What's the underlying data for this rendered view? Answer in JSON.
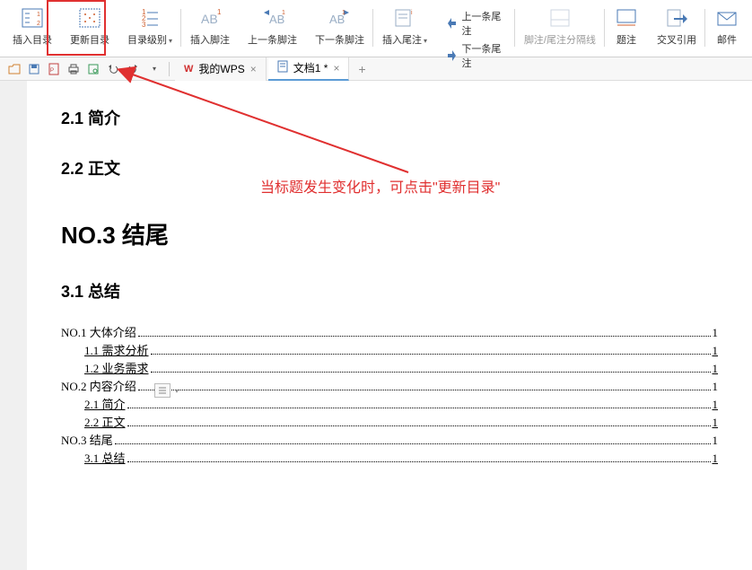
{
  "ribbon": {
    "insert_toc": "插入目录",
    "update_toc": "更新目录",
    "toc_level": "目录级别",
    "insert_footnote": "插入脚注",
    "prev_footnote": "上一条脚注",
    "next_footnote": "下一条脚注",
    "insert_endnote": "插入尾注",
    "prev_endnote": "上一条尾注",
    "next_endnote": "下一条尾注",
    "sep_line": "脚注/尾注分隔线",
    "caption": "题注",
    "cross_ref": "交叉引用",
    "mail": "邮件"
  },
  "tabs": {
    "wps_home": "我的WPS",
    "doc1": "文档1 *"
  },
  "doc": {
    "h21": "2.1 简介",
    "h22": "2.2 正文",
    "h1": "NO.3 结尾",
    "h23": "3.1 总结"
  },
  "annotation": {
    "text": "当标题发生变化时，可点击\"更新目录\""
  },
  "toc": [
    {
      "level": 1,
      "label": "NO.1 大体介绍",
      "page": "1",
      "ul": false
    },
    {
      "level": 2,
      "label": "1.1 需求分析",
      "page": "1",
      "ul": true
    },
    {
      "level": 2,
      "label": "1.2 业务需求",
      "page": "1",
      "ul": true
    },
    {
      "level": 1,
      "label": "NO.2 内容介绍",
      "page": "1",
      "ul": false
    },
    {
      "level": 2,
      "label": "2.1 简介",
      "page": "1",
      "ul": true
    },
    {
      "level": 2,
      "label": "2.2 正文",
      "page": "1",
      "ul": true
    },
    {
      "level": 1,
      "label": "NO.3 结尾",
      "page": "1",
      "ul": false
    },
    {
      "level": 2,
      "label": "3.1 总结",
      "page": "1",
      "ul": true
    }
  ]
}
